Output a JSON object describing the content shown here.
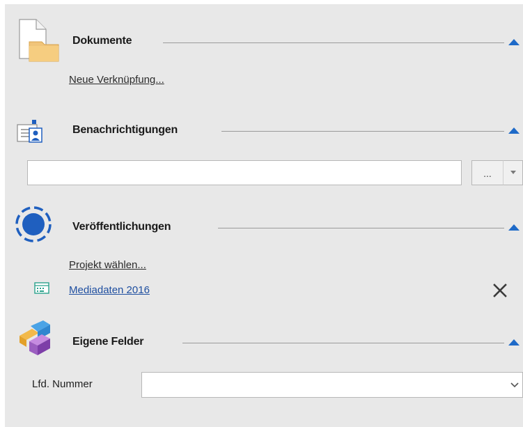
{
  "sections": {
    "documents": {
      "title": "Dokumente",
      "icon": "document-folder-icon",
      "link": "Neue Verknüpfung..."
    },
    "notifications": {
      "title": "Benachrichtigungen",
      "icon": "contact-card-icon",
      "input_value": "",
      "browse_label": "...",
      "dropdown_icon": "chevron-down-icon"
    },
    "publications": {
      "title": "Veröffentlichungen",
      "icon": "circle-progress-icon",
      "select_link": "Projekt wählen...",
      "item": {
        "label": "Mediadaten 2016",
        "icon": "media-sheet-icon",
        "remove_icon": "close-icon"
      }
    },
    "custom_fields": {
      "title": "Eigene Felder",
      "icon": "cubes-icon",
      "field_label": "Lfd. Nummer",
      "field_value": ""
    }
  },
  "colors": {
    "panel_bg": "#e8e8e8",
    "accent_blue": "#1f5fbf",
    "link_blue": "#1f4fa0",
    "collapse_arrow": "#1e6ac8"
  }
}
